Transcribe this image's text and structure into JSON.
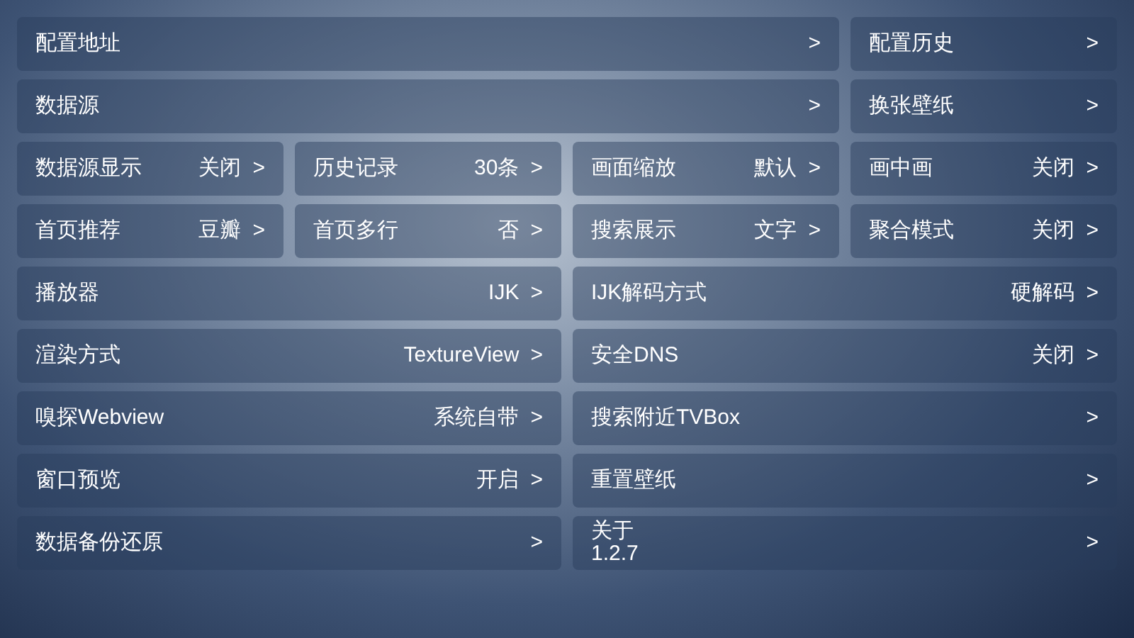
{
  "rows": [
    {
      "kind": "main_side",
      "cells": [
        {
          "label": "配置地址",
          "arrow": ">"
        },
        {
          "label": "配置历史",
          "arrow": ">"
        }
      ]
    },
    {
      "kind": "main_side",
      "cells": [
        {
          "label": "数据源",
          "arrow": ">"
        },
        {
          "label": "换张壁纸",
          "arrow": ">"
        }
      ]
    },
    {
      "kind": "quarters",
      "cells": [
        {
          "label": "数据源显示",
          "value": "关闭",
          "arrow": ">"
        },
        {
          "label": "历史记录",
          "value": "30条",
          "arrow": ">"
        },
        {
          "label": "画面缩放",
          "value": "默认",
          "arrow": ">"
        },
        {
          "label": "画中画",
          "value": "关闭",
          "arrow": ">"
        }
      ]
    },
    {
      "kind": "quarters",
      "cells": [
        {
          "label": "首页推荐",
          "value": "豆瓣",
          "arrow": ">"
        },
        {
          "label": "首页多行",
          "value": "否",
          "arrow": ">"
        },
        {
          "label": "搜索展示",
          "value": "文字",
          "arrow": ">"
        },
        {
          "label": "聚合模式",
          "value": "关闭",
          "arrow": ">"
        }
      ]
    },
    {
      "kind": "halves",
      "cells": [
        {
          "label": "播放器",
          "value": "IJK",
          "arrow": ">"
        },
        {
          "label": "IJK解码方式",
          "value": "硬解码",
          "arrow": ">"
        }
      ]
    },
    {
      "kind": "halves",
      "cells": [
        {
          "label": "渲染方式",
          "value": "TextureView",
          "arrow": ">"
        },
        {
          "label": "安全DNS",
          "value": "关闭",
          "arrow": ">"
        }
      ]
    },
    {
      "kind": "halves",
      "cells": [
        {
          "label": "嗅探Webview",
          "value": "系统自带",
          "arrow": ">"
        },
        {
          "label": "搜索附近TVBox",
          "arrow": ">"
        }
      ]
    },
    {
      "kind": "halves",
      "cells": [
        {
          "label": "窗口预览",
          "value": "开启",
          "arrow": ">"
        },
        {
          "label": "重置壁纸",
          "arrow": ">"
        }
      ]
    },
    {
      "kind": "halves",
      "cells": [
        {
          "label": "数据备份还原",
          "arrow": ">"
        },
        {
          "label": "关于",
          "sublabel": "1.2.7",
          "arrow": ">"
        }
      ]
    }
  ]
}
